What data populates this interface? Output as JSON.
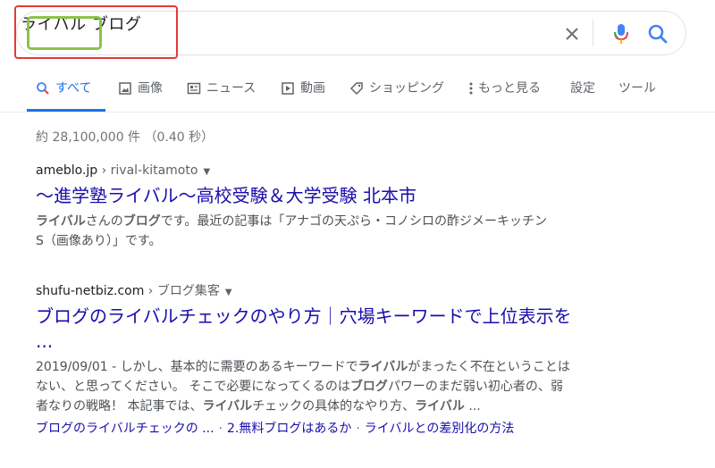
{
  "search": {
    "query": "ライバル ブログ",
    "query_part1": "ライバル",
    "query_part2": "ブログ"
  },
  "icons": {
    "clear": "close-icon",
    "mic": "mic-icon",
    "search": "search-icon"
  },
  "tabs": [
    {
      "label": "すべて",
      "icon": "search-icon",
      "active": true
    },
    {
      "label": "画像",
      "icon": "image-icon"
    },
    {
      "label": "ニュース",
      "icon": "news-icon"
    },
    {
      "label": "動画",
      "icon": "video-icon"
    },
    {
      "label": "ショッピング",
      "icon": "tag-icon"
    },
    {
      "label": "もっと見る",
      "icon": "more-vert-icon"
    },
    {
      "label": "設定"
    },
    {
      "label": "ツール"
    }
  ],
  "stats": "約 28,100,000 件 （0.40 秒）",
  "results": [
    {
      "domain": "ameblo.jp",
      "path": " › rival-kitamoto",
      "title": "～進学塾ライバル～高校受験＆大学受験 北本市",
      "snippet": {
        "b1": "ライバル",
        "t1": "さんの",
        "b2": "ブログ",
        "t2": "です。最近の記事は「アナゴの天ぷら・コノシロの酢ジメーキッチン",
        "t3": "S（画像あり）」です。"
      }
    },
    {
      "domain": "shufu-netbiz.com",
      "path": " › ブログ集客",
      "title_line1": "ブログのライバルチェックのやり方｜穴場キーワードで上位表示を",
      "title_line2": "...",
      "snippet": {
        "t1": "2019/09/01 - しかし、基本的に需要のあるキーワードで",
        "b1": "ライバル",
        "t2": "がまったく不在ということは",
        "t3": "ない、と思ってください。 そこで必要になってくるのは",
        "b2": "ブログ",
        "t4": "パワーのまだ弱い初心者の、弱",
        "t5": "者なりの戦略！ 本記事では、",
        "b3": "ライバル",
        "t6": "チェックの具体的なやり方、",
        "b4": "ライバル",
        "t7": " ..."
      },
      "sitelinks": [
        "ブログのライバルチェックの ...",
        "2.無料ブログはあるか",
        "ライバルとの差別化の方法"
      ],
      "sitelink_sep": "·"
    }
  ],
  "colors": {
    "link": "#1a0dab",
    "accent": "#1a73e8",
    "highlight_outer": "#e53935",
    "highlight_inner": "#8bc34a"
  }
}
